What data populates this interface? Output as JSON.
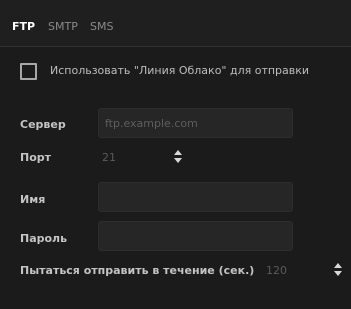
{
  "tabs": [
    {
      "label": "FTP",
      "active": true
    },
    {
      "label": "SMTP",
      "active": false
    },
    {
      "label": "SMS",
      "active": false
    }
  ],
  "cloud_option": {
    "label": "Использовать \"Линия Облако\" для отправки",
    "checked": false
  },
  "form": {
    "server_label": "Сервер",
    "server_placeholder": "ftp.example.com",
    "server_value": "",
    "port_label": "Порт",
    "port_value": "21",
    "name_label": "Имя",
    "name_value": "",
    "password_label": "Пароль",
    "password_value": "",
    "timeout_label": "Пытаться отправить в течение (сек.)",
    "timeout_value": "120"
  },
  "icons": {
    "stepper": "up-down-arrows-icon",
    "checkbox": "checkbox-unchecked-icon"
  },
  "colors": {
    "background": "#1b1b1b",
    "input_background": "#262626",
    "active_tab": "#ffffff",
    "inactive_tab": "#8a8a8a",
    "label": "#c4c4c4",
    "placeholder": "#5e5e5e"
  }
}
